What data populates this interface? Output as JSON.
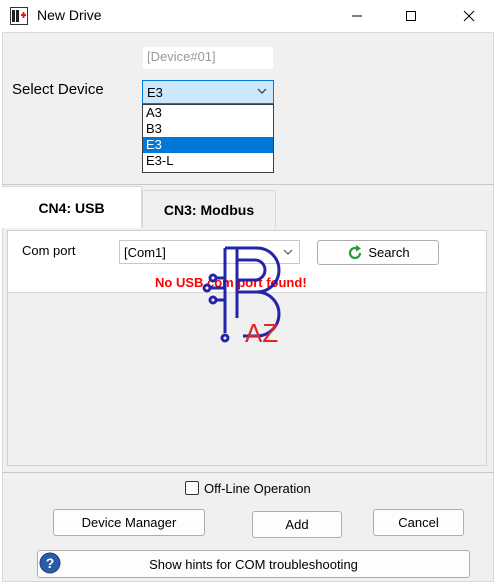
{
  "window": {
    "title": "New Drive"
  },
  "device": {
    "name_value": "[Device#01]",
    "select_label": "Select Device",
    "selected": "E3",
    "options": [
      "A3",
      "B3",
      "E3",
      "E3-L"
    ]
  },
  "tabs": [
    {
      "label": "CN4: USB"
    },
    {
      "label": "CN3: Modbus"
    }
  ],
  "usb": {
    "com_label": "Com port",
    "com_value": "[Com1]",
    "search_label": "Search",
    "error": "No USB com port found!"
  },
  "bottom": {
    "offline_label": "Off-Line Operation",
    "device_manager_label": "Device Manager",
    "add_label": "Add",
    "cancel_label": "Cancel",
    "hints_label": "Show hints for COM troubleshooting"
  },
  "watermark": {
    "text": "AZ"
  },
  "colors": {
    "accent": "#0078d7",
    "error": "#ff0000",
    "selection_bg": "#cce8ff",
    "watermark": "#1a1aa8",
    "watermark_accent": "#e01b1b"
  }
}
